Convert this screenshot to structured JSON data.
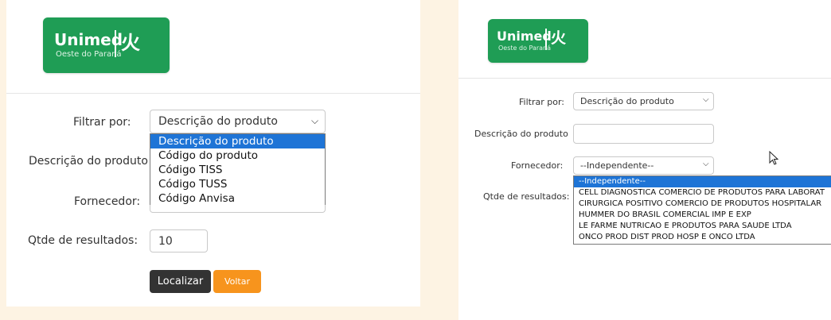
{
  "colors": {
    "brand_green": "#1f9d55",
    "accent_orange": "#f7941d",
    "dark_button": "#333333",
    "selection_blue": "#1e74d6"
  },
  "logo": {
    "brand": "Unimed",
    "subtitle": "Oeste do Paraná",
    "icon": "unimed-hands-icon"
  },
  "left": {
    "filtrar_label": "Filtrar por:",
    "filtrar_value": "Descrição do produto",
    "descricao_label": "Descrição do produto",
    "fornecedor_label": "Fornecedor:",
    "qtde_label": "Qtde de resultados:",
    "qtde_value": "10",
    "dropdown_options": [
      "Descrição do produto",
      "Código do produto",
      "Código TISS",
      "Código TUSS",
      "Código Anvisa"
    ],
    "localizar_label": "Localizar",
    "voltar_label": "Voltar"
  },
  "right": {
    "filtrar_label": "Filtrar por:",
    "filtrar_value": "Descrição do produto",
    "descricao_label": "Descrição do produto",
    "fornecedor_label": "Fornecedor:",
    "fornecedor_value": "--Independente--",
    "qtde_label": "Qtde de resultados:",
    "dropdown_options": [
      "--Independente--",
      "CELL DIAGNOSTICA COMERCIO DE PRODUTOS PARA LABORAT",
      "CIRURGICA POSITIVO COMERCIO DE PRODUTOS HOSPITALAR",
      "HUMMER DO BRASIL COMERCIAL IMP E EXP",
      "LE FARME NUTRICAO E PRODUTOS PARA SAUDE LTDA",
      "ONCO PROD DIST PROD HOSP E ONCO LTDA"
    ]
  }
}
